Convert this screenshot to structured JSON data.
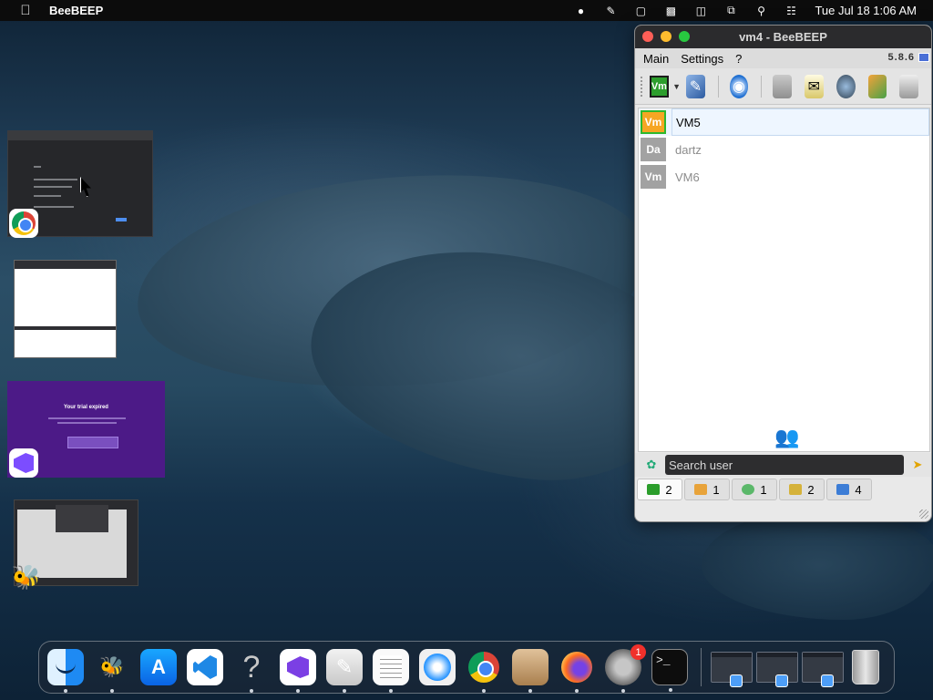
{
  "menubar": {
    "apple_icon": "apple-icon",
    "app_name": "BeeBEEP",
    "status_icons": [
      "beebeep-icon",
      "pen-icon",
      "info-icon",
      "display-icon",
      "screen-icon",
      "window-icon",
      "search-icon",
      "control-center-icon"
    ],
    "clock": "Tue Jul 18  1:06 AM"
  },
  "thumbnails": {
    "trial_title": "Your trial expired"
  },
  "beebeep_window": {
    "title": "vm4 - BeeBEEP",
    "menu": [
      "Main",
      "Settings",
      "?"
    ],
    "version": "5.8.6",
    "status_button_label": "Vm",
    "users": [
      {
        "initials": "Vm",
        "name": "VM5",
        "online": true
      },
      {
        "initials": "Da",
        "name": "dartz",
        "online": false
      },
      {
        "initials": "Vm",
        "name": "VM6",
        "online": false
      }
    ],
    "search": {
      "placeholder": "Search user",
      "value": ""
    },
    "tabs": [
      {
        "icon": "users-icon",
        "count": "2"
      },
      {
        "icon": "group-icon",
        "count": "1"
      },
      {
        "icon": "chat-icon",
        "count": "1"
      },
      {
        "icon": "groups-icon",
        "count": "2"
      },
      {
        "icon": "plugin-icon",
        "count": "4"
      }
    ]
  },
  "dock": {
    "apps": [
      "Finder",
      "BeeBEEP",
      "App Store",
      "Visual Studio Code",
      "Help",
      "Visual Studio",
      "Script Editor",
      "TextEdit",
      "Safari",
      "Google Chrome",
      "Archive Utility",
      "Firefox",
      "System Preferences",
      "Terminal"
    ],
    "settings_badge": "1",
    "terminal_prompt": ">_"
  }
}
